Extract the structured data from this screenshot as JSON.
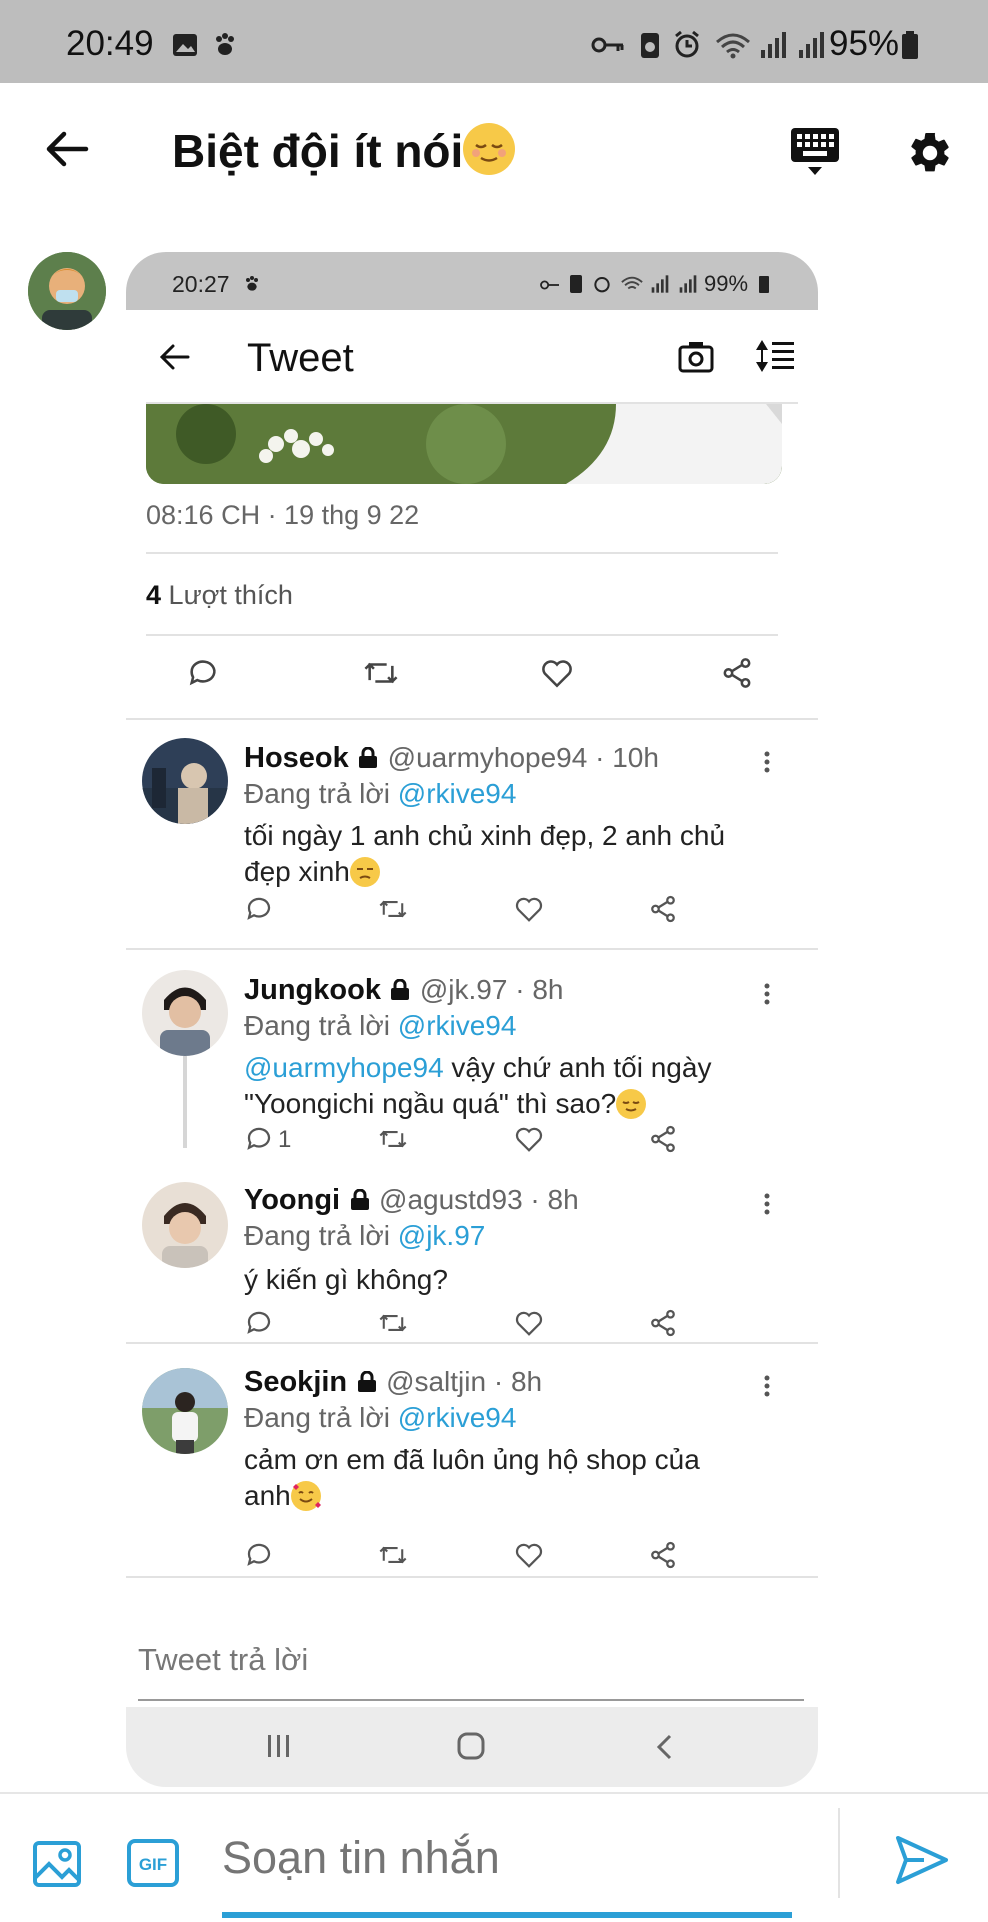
{
  "status_bar": {
    "time": "20:49",
    "battery": "95%"
  },
  "header": {
    "title": "Biệt đội ít nói",
    "title_emoji": "relieved-face-emoji"
  },
  "screenshot": {
    "status": {
      "time": "20:27",
      "battery": "99%"
    },
    "title": "Tweet",
    "timestamp": "08:16 CH · 19 thg 9 22",
    "likes": {
      "count": "4",
      "label": "Lượt thích"
    },
    "replies": [
      {
        "name": "Hoseok",
        "handle": "@uarmyhope94 · 10h",
        "replying_label": "Đang trả lời",
        "replying_to": "@rkive94",
        "text_lines": [
          "tối ngày 1 anh chủ xinh đẹp, 2 anh chủ",
          "đẹp xinh"
        ],
        "reply_count": ""
      },
      {
        "name": "Jungkook",
        "handle": "@jk.97 · 8h",
        "replying_label": "Đang trả lời",
        "replying_to": "@rkive94",
        "mention": "@uarmyhope94",
        "text_lines": [
          " vậy chứ anh tối ngày",
          "\"Yoongichi ngầu quá\" thì sao?"
        ],
        "reply_count": "1"
      },
      {
        "name": "Yoongi",
        "handle": "@agustd93 · 8h",
        "replying_label": "Đang trả lời",
        "replying_to": "@jk.97",
        "text_lines": [
          "ý kiến gì không?"
        ],
        "reply_count": ""
      },
      {
        "name": "Seokjin",
        "handle": "@saltjin · 8h",
        "replying_label": "Đang trả lời",
        "replying_to": "@rkive94",
        "text_lines": [
          "cảm ơn em đã luôn ủng hộ shop của",
          "anh"
        ],
        "reply_count": ""
      }
    ],
    "reply_placeholder": "Tweet trả lời"
  },
  "composer": {
    "placeholder": "Soạn tin nhắn"
  },
  "colors": {
    "accent": "#2b9fd6",
    "status_bar": "#bdbdbd"
  }
}
